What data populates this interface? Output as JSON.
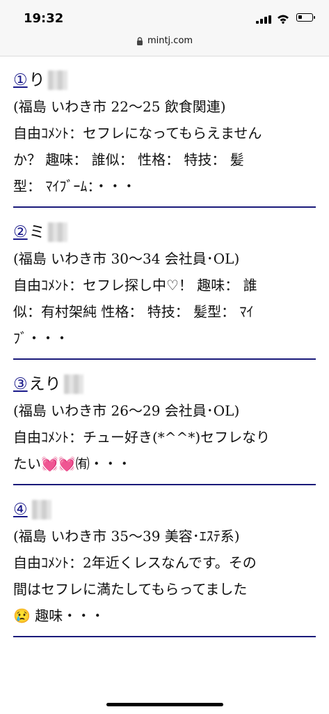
{
  "status": {
    "time": "19:32"
  },
  "browser": {
    "url": "mintj.com"
  },
  "entries": [
    {
      "number": "①",
      "name": "り",
      "lines": [
        "(福島 いわき市 22〜25 飲食関連)",
        "自由ｺﾒﾝﾄ：セフレになってもらえません",
        "か？ 趣味： 誰似： 性格： 特技： 髪",
        "型： ﾏｲﾌﾞｰﾑ：・・・"
      ]
    },
    {
      "number": "②",
      "name": "ミ",
      "lines": [
        "(福島 いわき市 30〜34 会社員･OL)",
        "自由ｺﾒﾝﾄ：セフレ探し中♡！ 趣味： 誰",
        "似：有村架純 性格： 特技： 髪型： ﾏｲ",
        "ﾌﾞ・・・"
      ]
    },
    {
      "number": "③",
      "name": "えり",
      "lines": [
        "(福島 いわき市 26〜29 会社員･OL)",
        "自由ｺﾒﾝﾄ：チュー好き(*^^*)セフレなり",
        "たい💓💓㈲・・・"
      ]
    },
    {
      "number": "④",
      "name": "",
      "lines": [
        "(福島 いわき市 35〜39 美容･ｴｽﾃ系)",
        "自由ｺﾒﾝﾄ：2年近くレスなんです。その",
        "間はセフレに満たしてもらってました",
        "😢 趣味・・・"
      ]
    }
  ]
}
